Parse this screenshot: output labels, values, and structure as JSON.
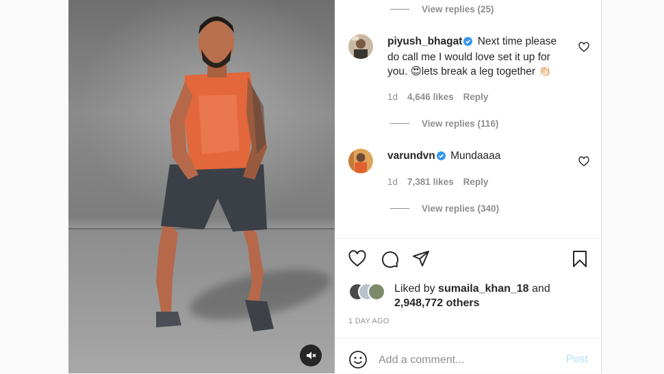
{
  "comments": [
    {
      "type": "replies",
      "view_replies": "View replies (25)"
    },
    {
      "username": "piyush_bhagat",
      "verified": true,
      "text": "Next time please do call me I would love set it up for you. 😍lets break a leg together 👏🏻",
      "time": "1d",
      "likes": "4,646 likes",
      "reply_label": "Reply",
      "view_replies": "View replies (116)"
    },
    {
      "username": "varundvn",
      "verified": true,
      "text": "Mundaaaa",
      "time": "1d",
      "likes": "7,381 likes",
      "reply_label": "Reply",
      "view_replies": "View replies (340)"
    }
  ],
  "actions": {
    "like_icon": "heart-icon",
    "comment_icon": "comment-icon",
    "share_icon": "paper-plane-icon",
    "save_icon": "bookmark-icon"
  },
  "liked_by": {
    "prefix": "Liked by",
    "user": "sumaila_khan_18",
    "mid": "and",
    "others": "2,948,772 others"
  },
  "post_date": "1 DAY AGO",
  "add_comment": {
    "placeholder": "Add a comment...",
    "post_label": "Post"
  },
  "colors": {
    "verified": "#3897f0",
    "muted_text": "#8e8e8e",
    "post_disabled": "#b2dffc"
  }
}
